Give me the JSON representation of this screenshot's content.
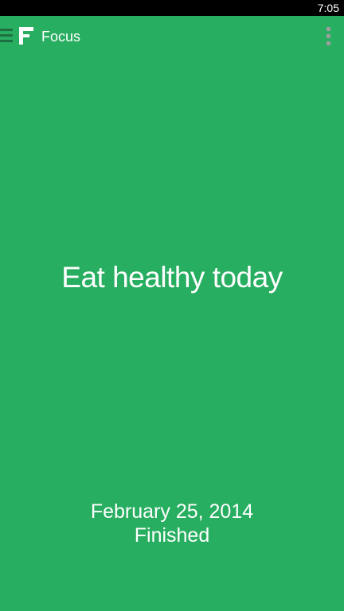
{
  "status_bar": {
    "time": "7:05"
  },
  "action_bar": {
    "title": "Focus",
    "logo_icon": "focus-f-logo-icon",
    "menu_icon": "hamburger-menu-icon",
    "overflow_icon": "overflow-dots-icon"
  },
  "goal": {
    "text": "Eat healthy today",
    "date": "February 25, 2014",
    "status": "Finished"
  },
  "colors": {
    "background": "#27ae60",
    "status_bar": "#000000",
    "text": "#ffffff",
    "overflow_icon": "#9e9e9e"
  }
}
